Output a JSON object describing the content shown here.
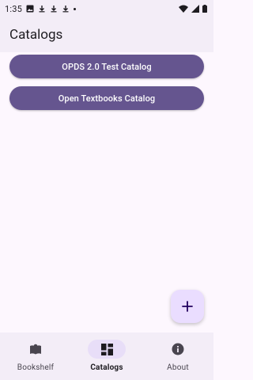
{
  "status_bar": {
    "time": "1:35"
  },
  "app_bar": {
    "title": "Catalogs"
  },
  "catalogs": [
    {
      "label": "OPDS 2.0 Test Catalog"
    },
    {
      "label": "Open Textbooks Catalog"
    }
  ],
  "fab": {
    "icon": "plus-icon"
  },
  "bottom_nav": {
    "items": [
      {
        "label": "Bookshelf",
        "icon": "book-icon",
        "active": false
      },
      {
        "label": "Catalogs",
        "icon": "dashboard-icon",
        "active": true
      },
      {
        "label": "About",
        "icon": "info-icon",
        "active": false
      }
    ]
  },
  "colors": {
    "primary": "#65558f",
    "surface": "#fdf7fe",
    "surface_container": "#f3edf7",
    "fab": "#eaddff",
    "nav_indicator": "#e8def8"
  }
}
